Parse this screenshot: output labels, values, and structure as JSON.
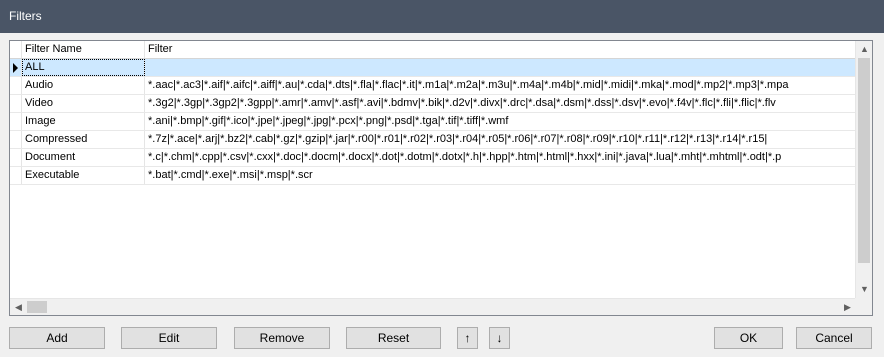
{
  "window": {
    "title": "Filters"
  },
  "grid": {
    "columns": [
      "Filter Name",
      "Filter"
    ],
    "rows": [
      {
        "name": "ALL",
        "filter": ""
      },
      {
        "name": "Audio",
        "filter": "*.aac|*.ac3|*.aif|*.aifc|*.aiff|*.au|*.cda|*.dts|*.fla|*.flac|*.it|*.m1a|*.m2a|*.m3u|*.m4a|*.m4b|*.mid|*.midi|*.mka|*.mod|*.mp2|*.mp3|*.mpa"
      },
      {
        "name": "Video",
        "filter": "*.3g2|*.3gp|*.3gp2|*.3gpp|*.amr|*.amv|*.asf|*.avi|*.bdmv|*.bik|*.d2v|*.divx|*.drc|*.dsa|*.dsm|*.dss|*.dsv|*.evo|*.f4v|*.flc|*.fli|*.flic|*.flv"
      },
      {
        "name": "Image",
        "filter": "*.ani|*.bmp|*.gif|*.ico|*.jpe|*.jpeg|*.jpg|*.pcx|*.png|*.psd|*.tga|*.tif|*.tiff|*.wmf"
      },
      {
        "name": "Compressed",
        "filter": "*.7z|*.ace|*.arj|*.bz2|*.cab|*.gz|*.gzip|*.jar|*.r00|*.r01|*.r02|*.r03|*.r04|*.r05|*.r06|*.r07|*.r08|*.r09|*.r10|*.r11|*.r12|*.r13|*.r14|*.r15|"
      },
      {
        "name": "Document",
        "filter": "*.c|*.chm|*.cpp|*.csv|*.cxx|*.doc|*.docm|*.docx|*.dot|*.dotm|*.dotx|*.h|*.hpp|*.htm|*.html|*.hxx|*.ini|*.java|*.lua|*.mht|*.mhtml|*.odt|*.p"
      },
      {
        "name": "Executable",
        "filter": "*.bat|*.cmd|*.exe|*.msi|*.msp|*.scr"
      }
    ]
  },
  "buttons": {
    "add": "Add",
    "edit": "Edit",
    "remove": "Remove",
    "reset": "Reset",
    "up": "↑",
    "down": "↓",
    "ok": "OK",
    "cancel": "Cancel"
  },
  "icons": {
    "row_pointer": "current-row-arrow-icon",
    "scroll_up": "▲",
    "scroll_down": "▼",
    "scroll_left": "◀",
    "scroll_right": "▶"
  },
  "colors": {
    "titlebar": "#4a5566",
    "selection": "#cde8ff"
  }
}
